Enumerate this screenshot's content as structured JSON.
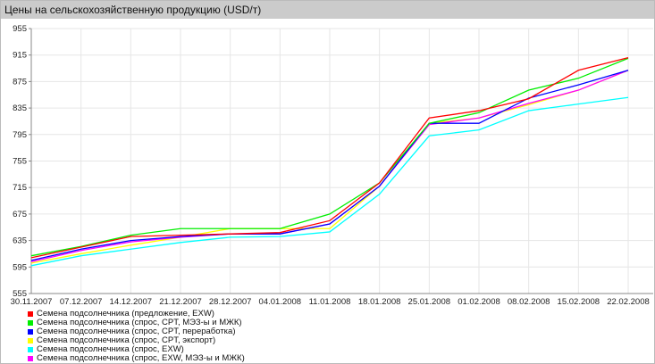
{
  "chart_data": {
    "type": "line",
    "title": "Цены на сельскохозяйственную продукцию (USD/т)",
    "xlabel": "",
    "ylabel": "",
    "ylim": [
      555,
      955
    ],
    "yticks": [
      955,
      915,
      875,
      835,
      795,
      755,
      715,
      675,
      635,
      595,
      555
    ],
    "categories": [
      "30.11.2007",
      "07.12.2007",
      "14.12.2007",
      "21.12.2007",
      "28.12.2007",
      "04.01.2008",
      "11.01.2008",
      "18.01.2008",
      "25.01.2008",
      "01.02.2008",
      "08.02.2008",
      "15.02.2008",
      "22.02.2008"
    ],
    "grid": true,
    "legend_position": "bottom-left",
    "series": [
      {
        "name": "Семена подсолнечника (предложение, EXW)",
        "color": "#ff0000",
        "values": [
          609,
          625,
          641,
          643,
          645,
          647,
          665,
          722,
          820,
          831,
          849,
          892,
          911
        ]
      },
      {
        "name": "Семена подсолнечника (спрос, CPT, МЭЗ-ы и МЖК)",
        "color": "#00ee00",
        "values": [
          612,
          626,
          643,
          653,
          653,
          653,
          675,
          722,
          812,
          828,
          862,
          880,
          910
        ]
      },
      {
        "name": "Семена подсолнечника (спрос, CPT, переработка)",
        "color": "#0000ff",
        "values": [
          605,
          622,
          635,
          641,
          645,
          645,
          660,
          717,
          812,
          812,
          850,
          870,
          892
        ]
      },
      {
        "name": "Семена подсолнечника (спрос, CPT, экспорт)",
        "color": "#ffff00",
        "values": [
          601,
          615,
          628,
          640,
          653,
          653,
          653,
          717,
          812,
          820,
          840,
          862,
          892
        ]
      },
      {
        "name": "Семена подсолнечника (спрос, EXW)",
        "color": "#00ffff",
        "values": [
          597,
          612,
          622,
          632,
          640,
          641,
          648,
          705,
          793,
          802,
          831,
          841,
          851
        ]
      },
      {
        "name": "Семена подсолнечника (спрос, EXW, МЭЗ-ы и МЖК)",
        "color": "#ff00ff",
        "values": [
          603,
          620,
          633,
          640,
          645,
          645,
          660,
          717,
          810,
          820,
          842,
          862,
          892
        ]
      }
    ]
  }
}
